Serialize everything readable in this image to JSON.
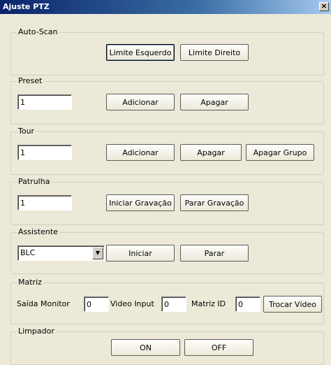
{
  "window": {
    "title": "Ajuste PTZ",
    "close_glyph": "×"
  },
  "autoscan": {
    "legend": "Auto-Scan",
    "left_limit_label": "Limite Esquerdo",
    "right_limit_label": "Limite Direito"
  },
  "preset": {
    "legend": "Preset",
    "value": "1",
    "add_label": "Adicionar",
    "delete_label": "Apagar"
  },
  "tour": {
    "legend": "Tour",
    "value": "1",
    "add_label": "Adicionar",
    "delete_label": "Apagar",
    "delete_group_label": "Apagar Grupo"
  },
  "patrol": {
    "legend": "Patrulha",
    "value": "1",
    "start_record_label": "Iniciar Gravação",
    "stop_record_label": "Parar Gravação"
  },
  "assistant": {
    "legend": "Assistente",
    "selected": "BLC",
    "start_label": "Iniciar",
    "stop_label": "Parar"
  },
  "matrix": {
    "legend": "Matriz",
    "output_monitor_label": "Saída Monitor",
    "output_monitor_value": "0",
    "video_input_label": "Video Input",
    "video_input_value": "0",
    "matrix_id_label": "Matriz ID",
    "matrix_id_value": "0",
    "switch_video_label": "Trocar Vídeo"
  },
  "wiper": {
    "legend": "Limpador",
    "on_label": "ON",
    "off_label": "OFF"
  }
}
